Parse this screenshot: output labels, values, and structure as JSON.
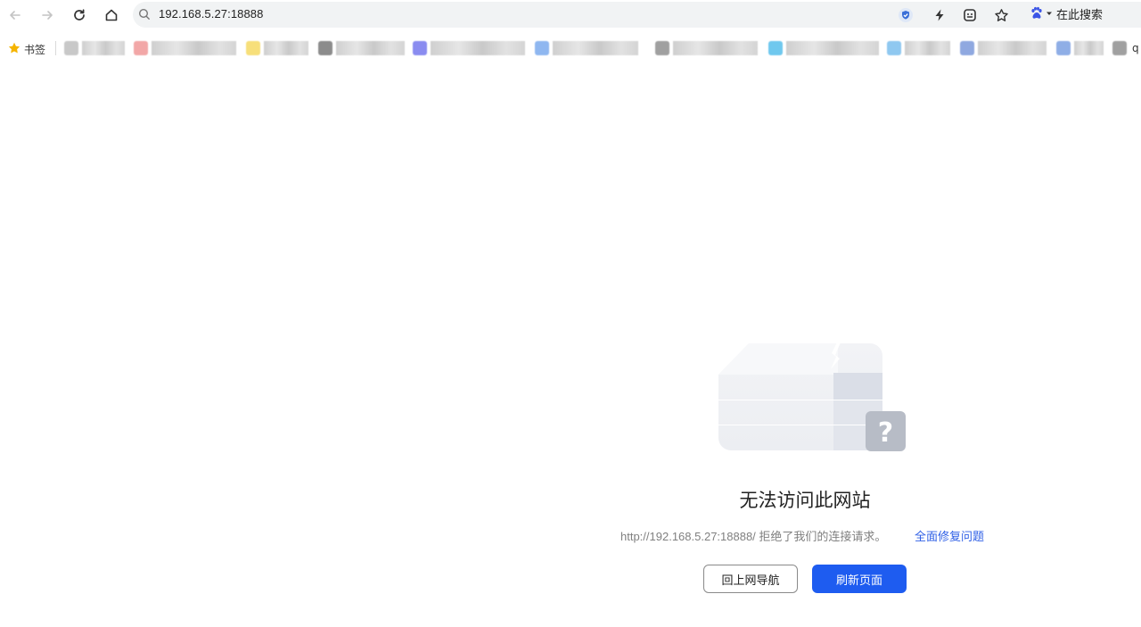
{
  "toolbar": {
    "back_icon": "arrow-left-icon",
    "forward_icon": "arrow-right-icon",
    "reload_icon": "reload-icon",
    "home_icon": "home-icon",
    "url": "192.168.5.27:18888",
    "search_engine_label": "在此搜索"
  },
  "bookmarks": {
    "label": "书签",
    "last_visible_char": "q",
    "items": [
      {
        "accent": "#c8c8c8"
      },
      {
        "accent": "#f2a7a7"
      },
      {
        "accent": "#f7df7a"
      },
      {
        "accent": "#8c8c8c"
      },
      {
        "accent": "#8a8cf0"
      },
      {
        "accent": "#8fb7f0"
      },
      {
        "accent": "#a0a0a0"
      },
      {
        "accent": "#6fc8ee"
      },
      {
        "accent": "#8fc8f0"
      },
      {
        "accent": "#8fa8e0"
      },
      {
        "accent": "#8faee6"
      },
      {
        "accent": "#a0a0a0"
      }
    ]
  },
  "error": {
    "title": "无法访问此网站",
    "description": "http://192.168.5.27:18888/ 拒绝了我们的连接请求。",
    "fix_link": "全面修复问题",
    "back_nav_button": "回上网导航",
    "refresh_button": "刷新页面"
  },
  "colors": {
    "primary": "#1e5cf0",
    "link": "#2e5fe6",
    "muted_text": "#808080"
  }
}
